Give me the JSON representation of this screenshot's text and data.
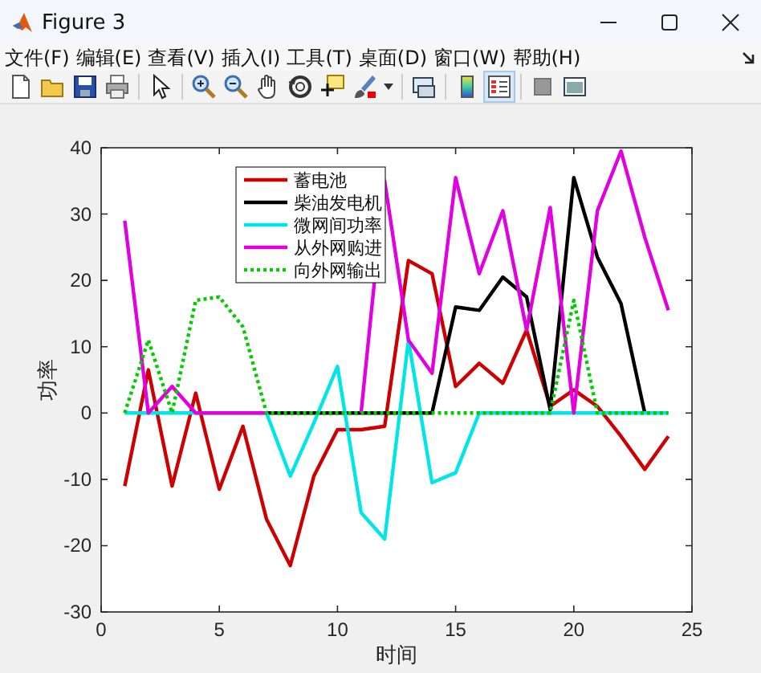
{
  "window": {
    "title": "Figure 3"
  },
  "menu": [
    "文件(F)",
    "编辑(E)",
    "查看(V)",
    "插入(I)",
    "工具(T)",
    "桌面(D)",
    "窗口(W)",
    "帮助(H)"
  ],
  "toolbar": [
    {
      "kind": "new",
      "selected": false
    },
    {
      "kind": "open",
      "selected": false
    },
    {
      "kind": "save",
      "selected": false
    },
    {
      "kind": "print",
      "selected": false
    },
    {
      "kind": "pointer",
      "selected": false
    },
    {
      "kind": "zoom_in",
      "selected": false
    },
    {
      "kind": "zoom_out",
      "selected": false
    },
    {
      "kind": "pan",
      "selected": false
    },
    {
      "kind": "rotate",
      "selected": false
    },
    {
      "kind": "cursor",
      "selected": false
    },
    {
      "kind": "brush",
      "selected": false
    },
    {
      "kind": "link",
      "selected": false
    },
    {
      "kind": "colorbar",
      "selected": false
    },
    {
      "kind": "legend",
      "selected": true
    },
    {
      "kind": "hide",
      "selected": false
    },
    {
      "kind": "panel",
      "selected": false
    }
  ],
  "figure": {
    "chart_data": {
      "type": "line",
      "legend": true,
      "xlabel": "时间",
      "ylabel": "功率",
      "x": [
        1,
        2,
        3,
        4,
        5,
        6,
        7,
        8,
        9,
        10,
        11,
        12,
        13,
        14,
        15,
        16,
        17,
        18,
        19,
        20,
        21,
        22,
        23,
        24
      ],
      "xlim": [
        0,
        25
      ],
      "ylim": [
        -30,
        40
      ],
      "xticks": [
        0,
        5,
        10,
        15,
        20,
        25
      ],
      "yticks": [
        -30,
        -20,
        -10,
        0,
        10,
        20,
        30,
        40
      ],
      "series": [
        {
          "name": "蓄电池",
          "color": "#cc0000",
          "line_style": "solid",
          "values": [
            -11,
            6.5,
            -11,
            3,
            -11.5,
            -2,
            -16,
            -23,
            -9.5,
            -2.5,
            -2.5,
            -2,
            23,
            21,
            4,
            7.5,
            4.5,
            12.5,
            1,
            3.5,
            1,
            -3.5,
            -8.5,
            -3.5
          ]
        },
        {
          "name": "柴油发电机",
          "color": "#000000",
          "line_style": "solid",
          "values": [
            null,
            null,
            null,
            null,
            null,
            null,
            0,
            0,
            0,
            0,
            0,
            0,
            0,
            0,
            16,
            15.5,
            20.5,
            17.5,
            0.5,
            35.5,
            23.5,
            16.5,
            0,
            null
          ]
        },
        {
          "name": "微网间功率",
          "color": "#00e5e5",
          "line_style": "solid",
          "values": [
            0,
            0,
            0,
            0,
            0,
            0,
            0,
            -9.5,
            -1.5,
            7,
            -15,
            -19,
            11,
            -10.5,
            -9,
            0,
            0,
            0,
            0,
            0,
            0,
            0,
            0,
            0
          ]
        },
        {
          "name": "从外网购进",
          "color": "#e000e0",
          "line_style": "solid",
          "values": [
            29,
            0,
            4,
            0,
            0,
            0,
            0,
            null,
            null,
            null,
            0,
            35,
            11,
            6,
            35.5,
            21,
            30.5,
            12.5,
            31,
            0,
            30.5,
            39.5,
            26.5,
            15.5
          ]
        },
        {
          "name": "向外网输出",
          "color": "#00cc00",
          "line_style": "dotted",
          "values": [
            0,
            11,
            0,
            17,
            17.5,
            13,
            0,
            0,
            0,
            0,
            0,
            0,
            0,
            0,
            0,
            0,
            0,
            0,
            0,
            17,
            0,
            0,
            0,
            0
          ]
        }
      ]
    }
  }
}
